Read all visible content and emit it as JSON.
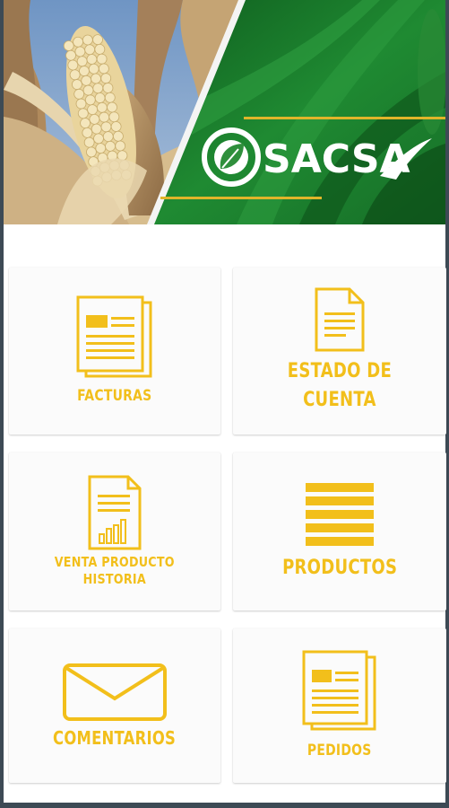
{
  "brand": {
    "name": "SACSA"
  },
  "colors": {
    "accent": "#f2bf1b",
    "green": "#1b7a2b",
    "tile_bg": "#fbfbfb"
  },
  "tiles": [
    {
      "label": "FACTURAS",
      "icon": "invoice-icon"
    },
    {
      "label": "ESTADO DE\nCUENTA",
      "icon": "document-icon"
    },
    {
      "label": "VENTA PRODUCTO\nHISTORIA",
      "icon": "report-chart-icon"
    },
    {
      "label": "PRODUCTOS",
      "icon": "list-icon"
    },
    {
      "label": "COMENTARIOS",
      "icon": "envelope-icon"
    },
    {
      "label": "PEDIDOS",
      "icon": "orders-icon"
    }
  ]
}
